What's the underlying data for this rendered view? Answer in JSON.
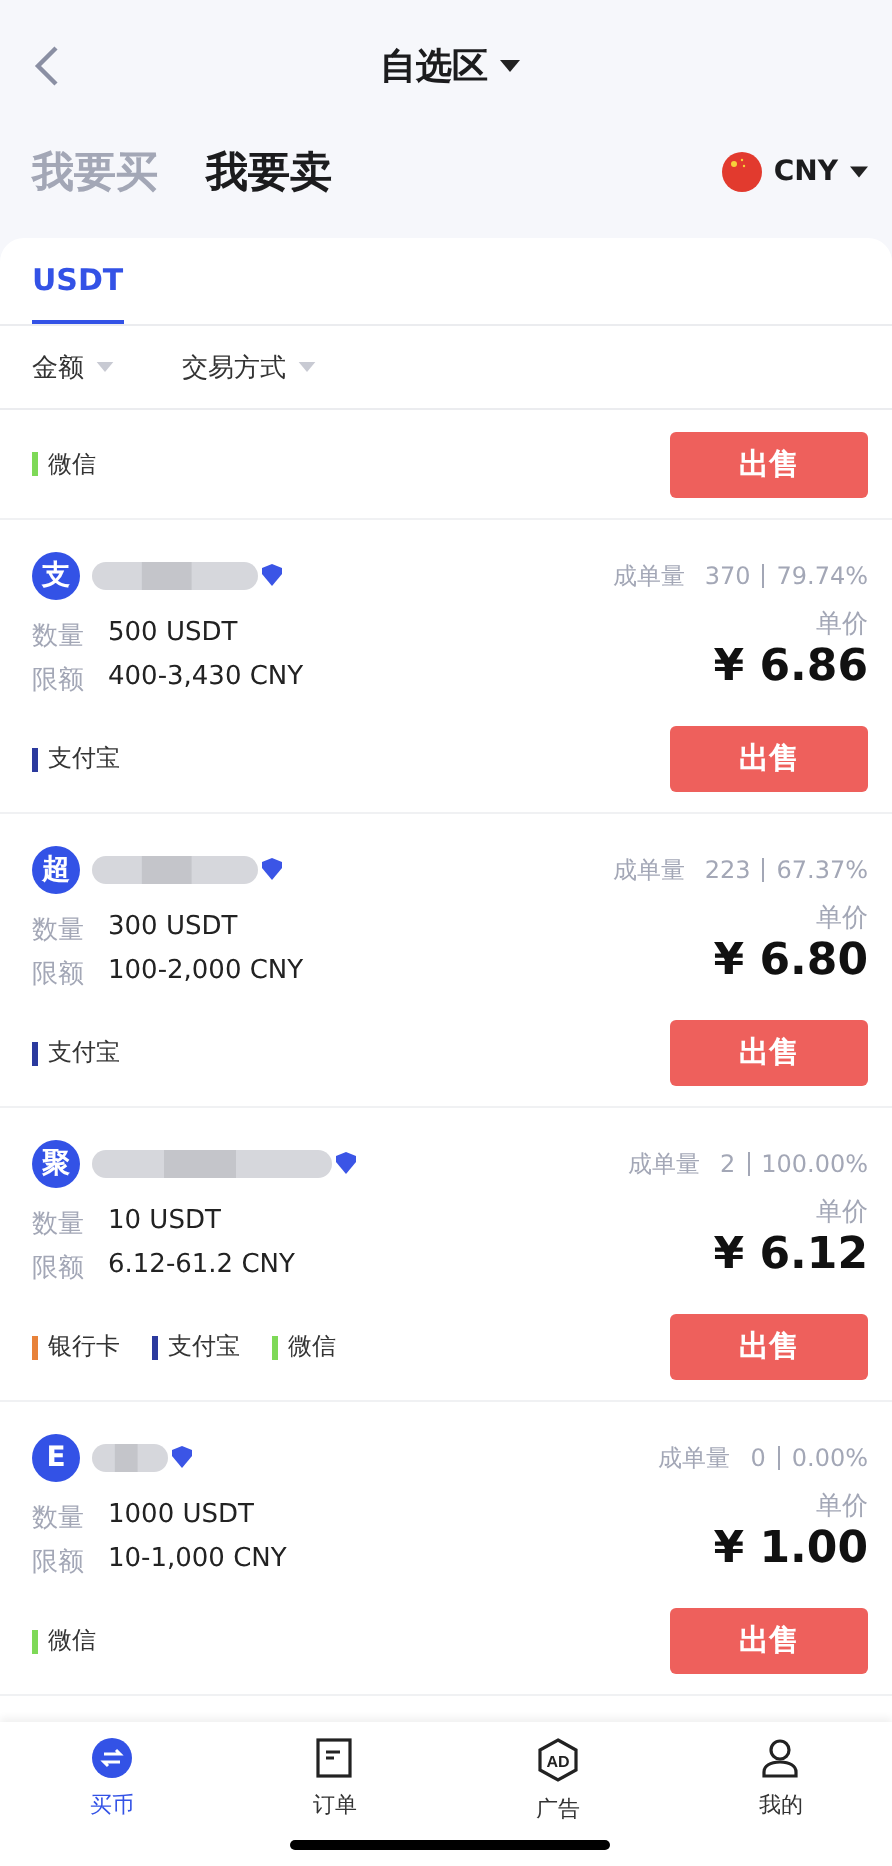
{
  "header": {
    "title": "自选区"
  },
  "side_tabs": [
    {
      "label": "我要买",
      "selected": false
    },
    {
      "label": "我要卖",
      "selected": true
    }
  ],
  "currency": {
    "code": "CNY"
  },
  "coin_tabs": [
    {
      "label": "USDT",
      "selected": true
    }
  ],
  "filters": [
    {
      "label": "金额"
    },
    {
      "label": "交易方式"
    }
  ],
  "partial_row": {
    "payments": [
      {
        "label": "微信",
        "color": "#7ed957"
      }
    ],
    "button": "出售"
  },
  "listings": [
    {
      "avatar": "支",
      "stats_label": "成单量",
      "orders": "370",
      "rate": "79.74%",
      "qty_label": "数量",
      "qty": "500 USDT",
      "limit_label": "限额",
      "limit": "400-3,430 CNY",
      "price_label": "单价",
      "price": "¥ 6.86",
      "payments": [
        {
          "label": "支付宝",
          "color": "#2b3a9e"
        }
      ],
      "button": "出售"
    },
    {
      "avatar": "超",
      "stats_label": "成单量",
      "orders": "223",
      "rate": "67.37%",
      "qty_label": "数量",
      "qty": "300 USDT",
      "limit_label": "限额",
      "limit": "100-2,000 CNY",
      "price_label": "单价",
      "price": "¥ 6.80",
      "payments": [
        {
          "label": "支付宝",
          "color": "#2b3a9e"
        }
      ],
      "button": "出售"
    },
    {
      "avatar": "聚",
      "stats_label": "成单量",
      "orders": "2",
      "rate": "100.00%",
      "qty_label": "数量",
      "qty": "10 USDT",
      "limit_label": "限额",
      "limit": "6.12-61.2 CNY",
      "price_label": "单价",
      "price": "¥ 6.12",
      "payments": [
        {
          "label": "银行卡",
          "color": "#e8823a"
        },
        {
          "label": "支付宝",
          "color": "#2b3a9e"
        },
        {
          "label": "微信",
          "color": "#7ed957"
        }
      ],
      "button": "出售"
    },
    {
      "avatar": "E",
      "stats_label": "成单量",
      "orders": "0",
      "rate": "0.00%",
      "qty_label": "数量",
      "qty": "1000 USDT",
      "limit_label": "限额",
      "limit": "10-1,000 CNY",
      "price_label": "单价",
      "price": "¥ 1.00",
      "payments": [
        {
          "label": "微信",
          "color": "#7ed957"
        }
      ],
      "button": "出售"
    }
  ],
  "nav": [
    {
      "label": "买币",
      "kind": "exchange",
      "selected": true
    },
    {
      "label": "订单",
      "kind": "document",
      "selected": false
    },
    {
      "label": "广告",
      "kind": "ad",
      "icon_text": "AD",
      "selected": false
    },
    {
      "label": "我的",
      "kind": "user",
      "selected": false
    }
  ]
}
